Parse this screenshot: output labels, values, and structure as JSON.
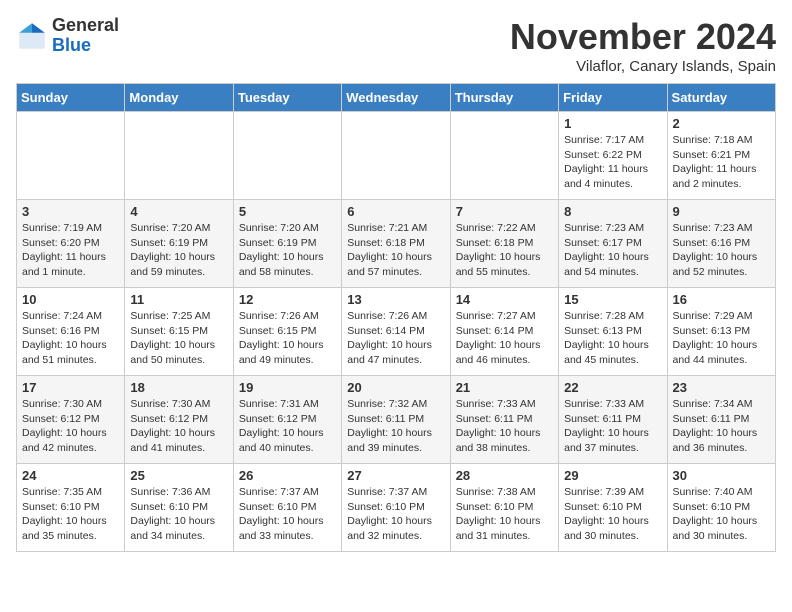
{
  "logo": {
    "text_general": "General",
    "text_blue": "Blue"
  },
  "header": {
    "month_title": "November 2024",
    "location": "Vilaflor, Canary Islands, Spain"
  },
  "weekdays": [
    "Sunday",
    "Monday",
    "Tuesday",
    "Wednesday",
    "Thursday",
    "Friday",
    "Saturday"
  ],
  "weeks": [
    [
      {
        "day": "",
        "info": ""
      },
      {
        "day": "",
        "info": ""
      },
      {
        "day": "",
        "info": ""
      },
      {
        "day": "",
        "info": ""
      },
      {
        "day": "",
        "info": ""
      },
      {
        "day": "1",
        "info": "Sunrise: 7:17 AM\nSunset: 6:22 PM\nDaylight: 11 hours and 4 minutes."
      },
      {
        "day": "2",
        "info": "Sunrise: 7:18 AM\nSunset: 6:21 PM\nDaylight: 11 hours and 2 minutes."
      }
    ],
    [
      {
        "day": "3",
        "info": "Sunrise: 7:19 AM\nSunset: 6:20 PM\nDaylight: 11 hours and 1 minute."
      },
      {
        "day": "4",
        "info": "Sunrise: 7:20 AM\nSunset: 6:19 PM\nDaylight: 10 hours and 59 minutes."
      },
      {
        "day": "5",
        "info": "Sunrise: 7:20 AM\nSunset: 6:19 PM\nDaylight: 10 hours and 58 minutes."
      },
      {
        "day": "6",
        "info": "Sunrise: 7:21 AM\nSunset: 6:18 PM\nDaylight: 10 hours and 57 minutes."
      },
      {
        "day": "7",
        "info": "Sunrise: 7:22 AM\nSunset: 6:18 PM\nDaylight: 10 hours and 55 minutes."
      },
      {
        "day": "8",
        "info": "Sunrise: 7:23 AM\nSunset: 6:17 PM\nDaylight: 10 hours and 54 minutes."
      },
      {
        "day": "9",
        "info": "Sunrise: 7:23 AM\nSunset: 6:16 PM\nDaylight: 10 hours and 52 minutes."
      }
    ],
    [
      {
        "day": "10",
        "info": "Sunrise: 7:24 AM\nSunset: 6:16 PM\nDaylight: 10 hours and 51 minutes."
      },
      {
        "day": "11",
        "info": "Sunrise: 7:25 AM\nSunset: 6:15 PM\nDaylight: 10 hours and 50 minutes."
      },
      {
        "day": "12",
        "info": "Sunrise: 7:26 AM\nSunset: 6:15 PM\nDaylight: 10 hours and 49 minutes."
      },
      {
        "day": "13",
        "info": "Sunrise: 7:26 AM\nSunset: 6:14 PM\nDaylight: 10 hours and 47 minutes."
      },
      {
        "day": "14",
        "info": "Sunrise: 7:27 AM\nSunset: 6:14 PM\nDaylight: 10 hours and 46 minutes."
      },
      {
        "day": "15",
        "info": "Sunrise: 7:28 AM\nSunset: 6:13 PM\nDaylight: 10 hours and 45 minutes."
      },
      {
        "day": "16",
        "info": "Sunrise: 7:29 AM\nSunset: 6:13 PM\nDaylight: 10 hours and 44 minutes."
      }
    ],
    [
      {
        "day": "17",
        "info": "Sunrise: 7:30 AM\nSunset: 6:12 PM\nDaylight: 10 hours and 42 minutes."
      },
      {
        "day": "18",
        "info": "Sunrise: 7:30 AM\nSunset: 6:12 PM\nDaylight: 10 hours and 41 minutes."
      },
      {
        "day": "19",
        "info": "Sunrise: 7:31 AM\nSunset: 6:12 PM\nDaylight: 10 hours and 40 minutes."
      },
      {
        "day": "20",
        "info": "Sunrise: 7:32 AM\nSunset: 6:11 PM\nDaylight: 10 hours and 39 minutes."
      },
      {
        "day": "21",
        "info": "Sunrise: 7:33 AM\nSunset: 6:11 PM\nDaylight: 10 hours and 38 minutes."
      },
      {
        "day": "22",
        "info": "Sunrise: 7:33 AM\nSunset: 6:11 PM\nDaylight: 10 hours and 37 minutes."
      },
      {
        "day": "23",
        "info": "Sunrise: 7:34 AM\nSunset: 6:11 PM\nDaylight: 10 hours and 36 minutes."
      }
    ],
    [
      {
        "day": "24",
        "info": "Sunrise: 7:35 AM\nSunset: 6:10 PM\nDaylight: 10 hours and 35 minutes."
      },
      {
        "day": "25",
        "info": "Sunrise: 7:36 AM\nSunset: 6:10 PM\nDaylight: 10 hours and 34 minutes."
      },
      {
        "day": "26",
        "info": "Sunrise: 7:37 AM\nSunset: 6:10 PM\nDaylight: 10 hours and 33 minutes."
      },
      {
        "day": "27",
        "info": "Sunrise: 7:37 AM\nSunset: 6:10 PM\nDaylight: 10 hours and 32 minutes."
      },
      {
        "day": "28",
        "info": "Sunrise: 7:38 AM\nSunset: 6:10 PM\nDaylight: 10 hours and 31 minutes."
      },
      {
        "day": "29",
        "info": "Sunrise: 7:39 AM\nSunset: 6:10 PM\nDaylight: 10 hours and 30 minutes."
      },
      {
        "day": "30",
        "info": "Sunrise: 7:40 AM\nSunset: 6:10 PM\nDaylight: 10 hours and 30 minutes."
      }
    ]
  ]
}
